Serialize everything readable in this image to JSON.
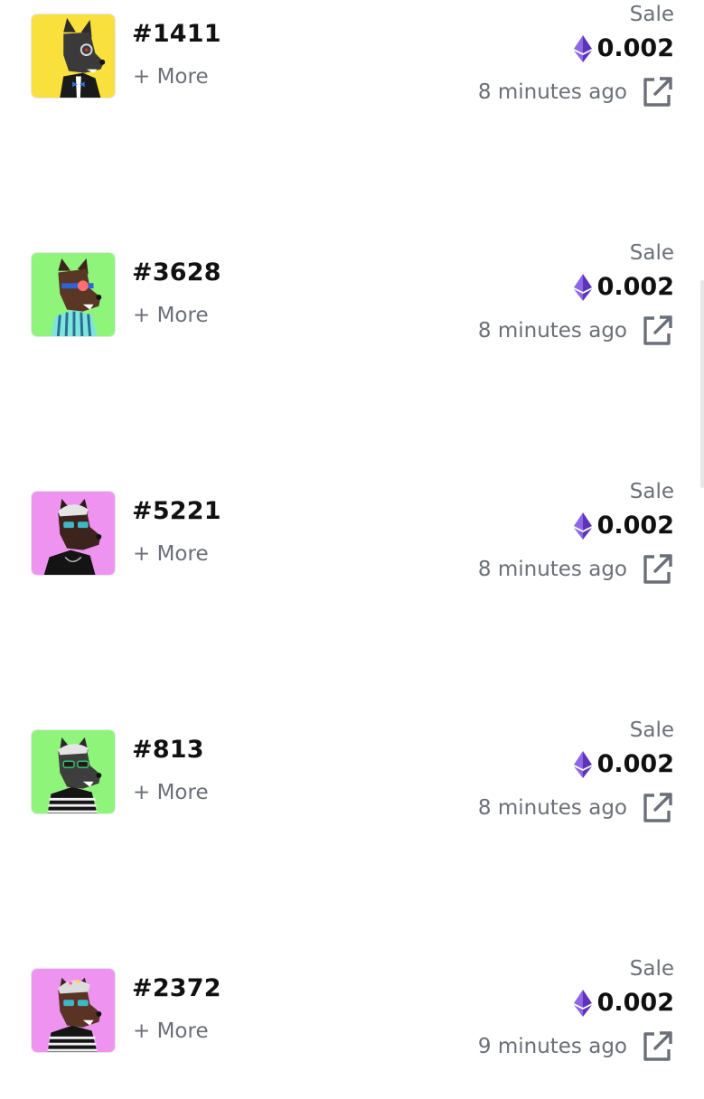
{
  "sales": [
    {
      "token_id": "#1411",
      "more_label": "+ More",
      "event_type": "Sale",
      "price": "0.002",
      "time_ago": "8 minutes ago",
      "thumbnail_bg": "#f9e03c",
      "thumbnail_icon": "wolf-avatar-tuxedo"
    },
    {
      "token_id": "#3628",
      "more_label": "+ More",
      "event_type": "Sale",
      "price": "0.002",
      "time_ago": "8 minutes ago",
      "thumbnail_bg": "#8ef57a",
      "thumbnail_icon": "wolf-avatar-striped-shirt"
    },
    {
      "token_id": "#5221",
      "more_label": "+ More",
      "event_type": "Sale",
      "price": "0.002",
      "time_ago": "8 minutes ago",
      "thumbnail_bg": "#ef93f1",
      "thumbnail_icon": "wolf-avatar-sunglasses"
    },
    {
      "token_id": "#813",
      "more_label": "+ More",
      "event_type": "Sale",
      "price": "0.002",
      "time_ago": "8 minutes ago",
      "thumbnail_bg": "#8ef57a",
      "thumbnail_icon": "wolf-avatar-striped-sweater"
    },
    {
      "token_id": "#2372",
      "more_label": "+ More",
      "event_type": "Sale",
      "price": "0.002",
      "time_ago": "9 minutes ago",
      "thumbnail_bg": "#ef93f1",
      "thumbnail_icon": "wolf-avatar-cap"
    }
  ],
  "colors": {
    "text_primary": "#111111",
    "text_secondary": "#6b6f78",
    "eth_purple": "#7b4fd6",
    "icon_gray": "#6b6f78"
  }
}
